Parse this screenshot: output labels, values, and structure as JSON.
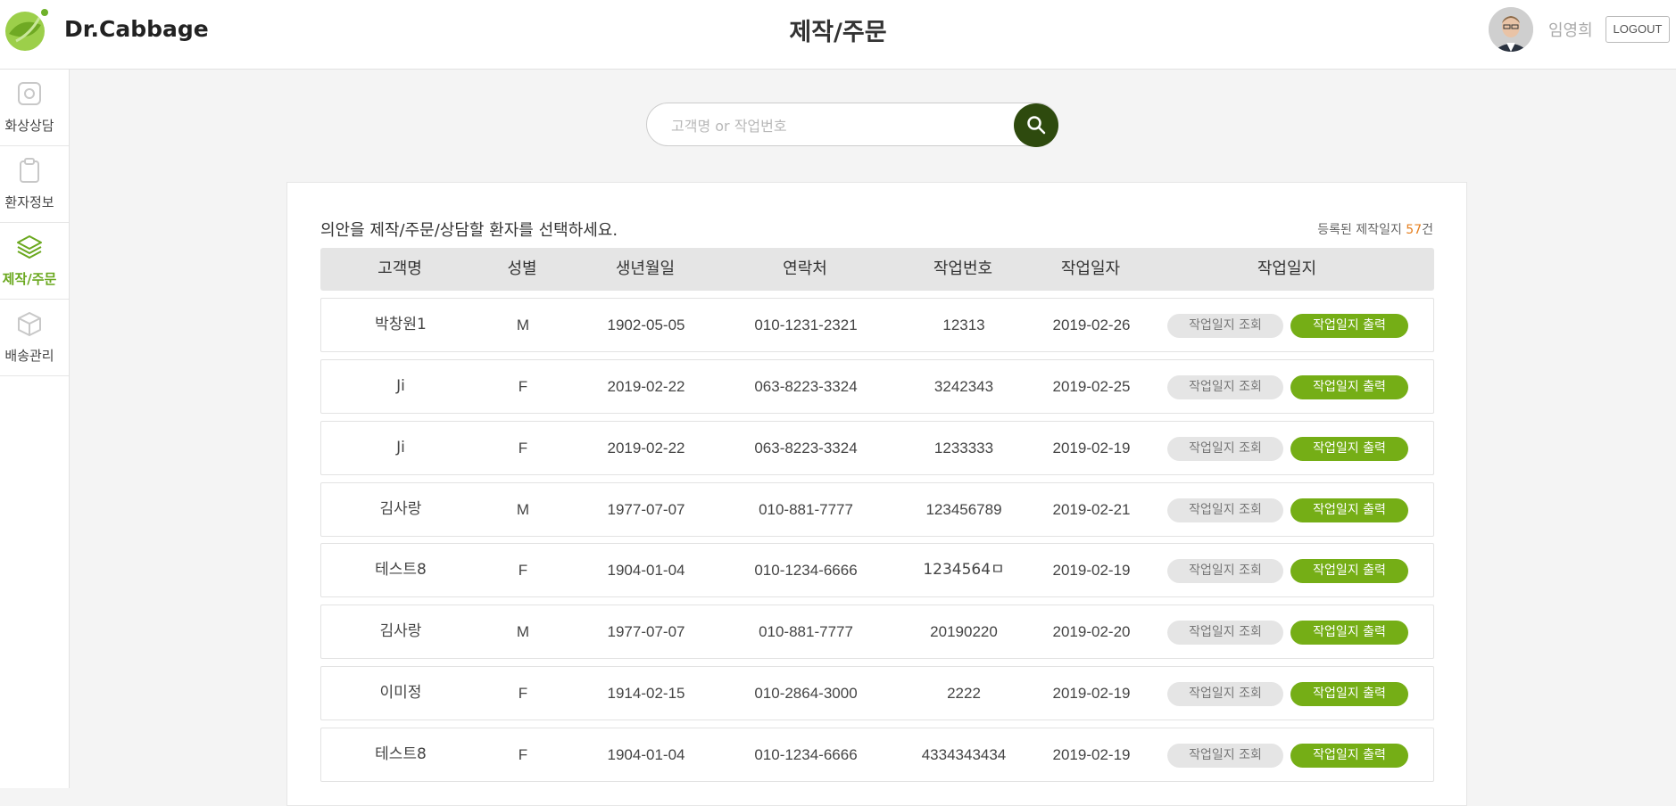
{
  "header": {
    "brand": "Dr.Cabbage",
    "title": "제작/주문",
    "user_name": "임영희",
    "logout_label": "LOGOUT"
  },
  "sidebar": {
    "items": [
      {
        "label": "화상상담",
        "icon": "camera-icon",
        "active": false
      },
      {
        "label": "환자정보",
        "icon": "clipboard-icon",
        "active": false
      },
      {
        "label": "제작/주문",
        "icon": "layers-icon",
        "active": true
      },
      {
        "label": "배송관리",
        "icon": "box-icon",
        "active": false
      }
    ]
  },
  "search": {
    "placeholder": "고객명 or 작업번호",
    "value": ""
  },
  "main": {
    "instruction": "의안을 제작/주문/상담할 환자를 선택하세요.",
    "count_prefix": "등록된 제작일지 ",
    "count_value": "57",
    "count_suffix": "건",
    "columns": [
      "고객명",
      "성별",
      "생년월일",
      "연락처",
      "작업번호",
      "작업일자",
      "작업일지"
    ],
    "view_label": "작업일지 조회",
    "print_label": "작업일지 출력",
    "rows": [
      {
        "name": "박창원1",
        "gender": "M",
        "birth": "1902-05-05",
        "phone": "010-1231-2321",
        "job_no": "12313",
        "date": "2019-02-26"
      },
      {
        "name": "Ji",
        "gender": "F",
        "birth": "2019-02-22",
        "phone": "063-8223-3324",
        "job_no": "3242343",
        "date": "2019-02-25"
      },
      {
        "name": "Ji",
        "gender": "F",
        "birth": "2019-02-22",
        "phone": "063-8223-3324",
        "job_no": "1233333",
        "date": "2019-02-19"
      },
      {
        "name": "김사랑",
        "gender": "M",
        "birth": "1977-07-07",
        "phone": "010-881-7777",
        "job_no": "123456789",
        "date": "2019-02-21"
      },
      {
        "name": "테스트8",
        "gender": "F",
        "birth": "1904-01-04",
        "phone": "010-1234-6666",
        "job_no": "1234564ㅁ",
        "date": "2019-02-19"
      },
      {
        "name": "김사랑",
        "gender": "M",
        "birth": "1977-07-07",
        "phone": "010-881-7777",
        "job_no": "20190220",
        "date": "2019-02-20"
      },
      {
        "name": "이미정",
        "gender": "F",
        "birth": "1914-02-15",
        "phone": "010-2864-3000",
        "job_no": "2222",
        "date": "2019-02-19"
      },
      {
        "name": "테스트8",
        "gender": "F",
        "birth": "1904-01-04",
        "phone": "010-1234-6666",
        "job_no": "4334343434",
        "date": "2019-02-19"
      }
    ]
  },
  "colors": {
    "accent_green": "#75ae16",
    "search_button": "#2e4a0e",
    "count_highlight": "#e57f1f"
  }
}
